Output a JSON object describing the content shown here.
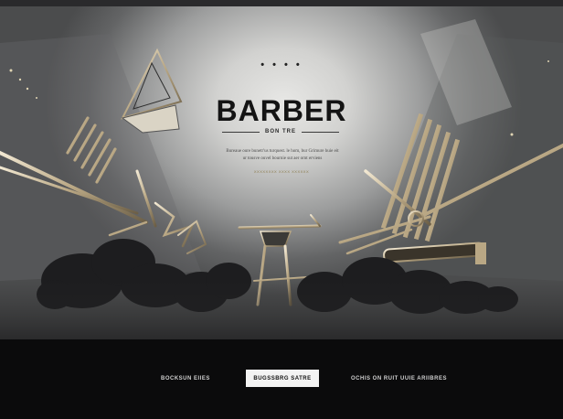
{
  "hero": {
    "dots": "• • • •",
    "title": "BARBER",
    "subtitle": "BON TRE",
    "description": "Bureaue oure bunetr'us turquest. le hom, bur Grimure huie eit ur tousve ouvel bournie sut aer ornt erviens",
    "link": "XXXXXXXX XXXX XXXXXX"
  },
  "footer": {
    "nav_left": "BOCKSUN EIIES",
    "cta": "BUGSSBRG SATRE",
    "nav_right": "OCHIS ON RUIT UUIE ARIIBRES"
  },
  "colors": {
    "accent_gold": "#b8a57a",
    "background": "#0b0b0c",
    "cta_background": "#f3f3f3"
  }
}
